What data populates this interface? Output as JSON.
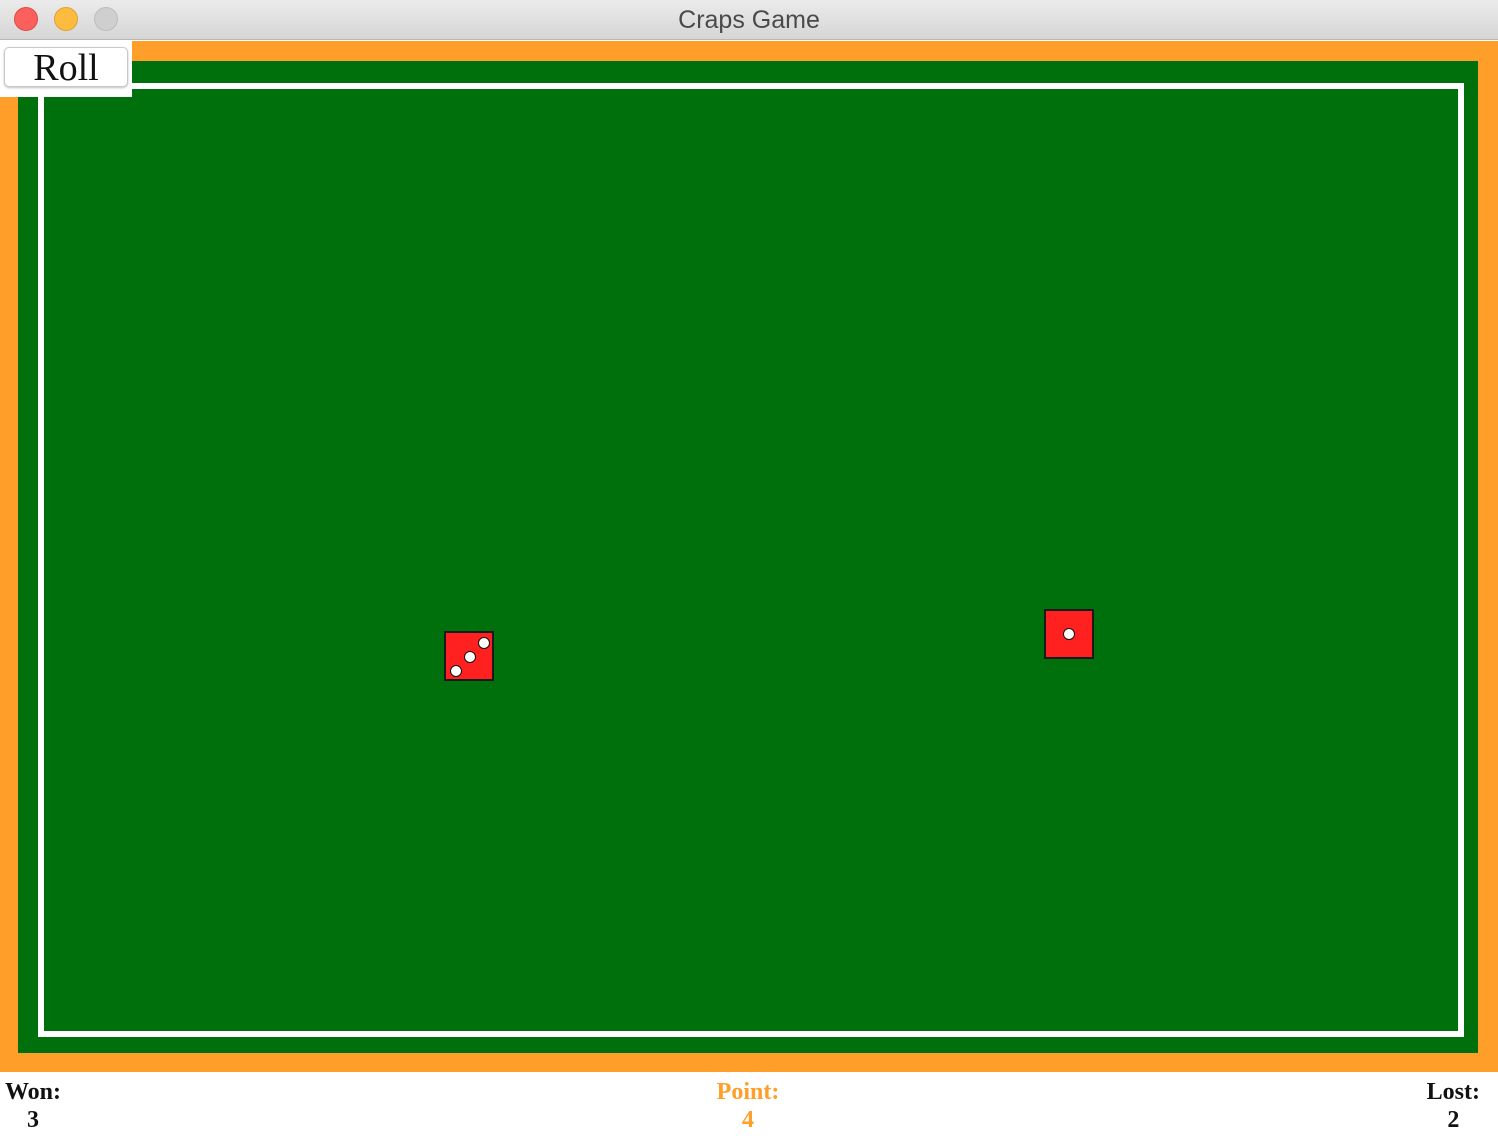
{
  "window": {
    "title": "Craps Game"
  },
  "toolbar": {
    "roll_label": "Roll"
  },
  "colors": {
    "border": "#ff9e28",
    "felt": "#00700d",
    "line": "#ffffff",
    "die": "#ff2020",
    "point": "#ff9e28"
  },
  "dice": [
    {
      "name": "die-1",
      "face": 3
    },
    {
      "name": "die-2",
      "face": 1
    }
  ],
  "status": {
    "won_label": "Won:",
    "won_value": "3",
    "point_label": "Point:",
    "point_value": "4",
    "lost_label": "Lost:",
    "lost_value": "2"
  }
}
